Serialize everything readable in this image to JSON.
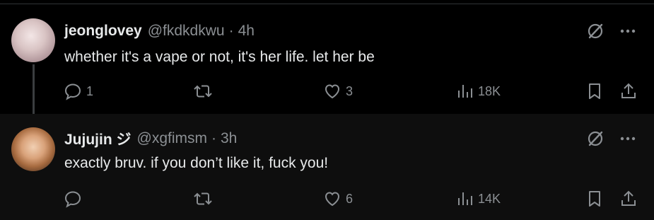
{
  "tweets": [
    {
      "name": "jeonglovey",
      "handle": "@fkdkdkwu",
      "dot": "·",
      "time": "4h",
      "text": "whether it's a vape or not, it's her life. let her be",
      "replies": "1",
      "retweets": "",
      "likes": "3",
      "views": "18K"
    },
    {
      "name": "Jujujin ジ",
      "handle": "@xgfimsm",
      "dot": "·",
      "time": "3h",
      "text": "exactly bruv. if you don’t like it, fuck you!",
      "replies": "",
      "retweets": "",
      "likes": "6",
      "views": "14K"
    }
  ],
  "icons": {
    "reply": "reply-icon",
    "retweet": "retweet-icon",
    "like": "like-icon",
    "views": "views-icon",
    "bookmark": "bookmark-icon",
    "share": "share-icon",
    "grok": "grok-icon",
    "more": "more-icon"
  },
  "colors": {
    "background": "#000000",
    "reply_background": "#0e0e0e",
    "text": "#e7e9ea",
    "muted": "#8b8f93"
  }
}
